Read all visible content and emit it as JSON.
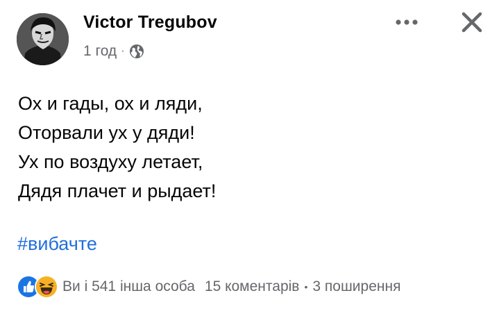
{
  "post": {
    "author": "Victor Tregubov",
    "time": "1 год",
    "meta_separator": "·",
    "privacy_icon": "globe-icon",
    "more_icon": "more-dots-icon",
    "close_icon": "close-icon",
    "lines": [
      "Ох и гады, ох и ляди,",
      "Оторвали ух у дяди!",
      "Ух по воздуху летает,",
      "Дядя плачет и рыдает!"
    ],
    "hashtag": "#вибачте"
  },
  "footer": {
    "reaction_icons": [
      "like-icon",
      "haha-icon"
    ],
    "reactions_text": "Ви і 541 інша особа",
    "comments": "15 коментарів",
    "separator": "•",
    "shares": "3 поширення"
  },
  "colors": {
    "text": "#050505",
    "secondary": "#65676b",
    "link": "#216fdb",
    "like_blue": "#1b74e4",
    "haha_yellow": "#f7b125"
  }
}
